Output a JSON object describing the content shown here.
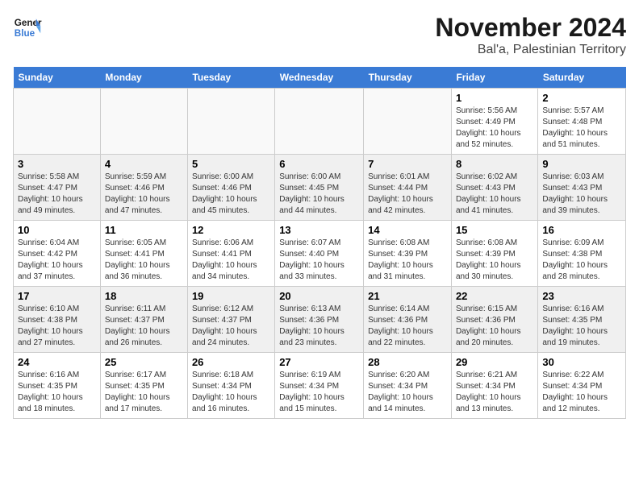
{
  "header": {
    "logo_line1": "General",
    "logo_line2": "Blue",
    "main_title": "November 2024",
    "subtitle": "Bal'a, Palestinian Territory"
  },
  "weekdays": [
    "Sunday",
    "Monday",
    "Tuesday",
    "Wednesday",
    "Thursday",
    "Friday",
    "Saturday"
  ],
  "weeks": [
    [
      {
        "day": "",
        "info": ""
      },
      {
        "day": "",
        "info": ""
      },
      {
        "day": "",
        "info": ""
      },
      {
        "day": "",
        "info": ""
      },
      {
        "day": "",
        "info": ""
      },
      {
        "day": "1",
        "info": "Sunrise: 5:56 AM\nSunset: 4:49 PM\nDaylight: 10 hours\nand 52 minutes."
      },
      {
        "day": "2",
        "info": "Sunrise: 5:57 AM\nSunset: 4:48 PM\nDaylight: 10 hours\nand 51 minutes."
      }
    ],
    [
      {
        "day": "3",
        "info": "Sunrise: 5:58 AM\nSunset: 4:47 PM\nDaylight: 10 hours\nand 49 minutes."
      },
      {
        "day": "4",
        "info": "Sunrise: 5:59 AM\nSunset: 4:46 PM\nDaylight: 10 hours\nand 47 minutes."
      },
      {
        "day": "5",
        "info": "Sunrise: 6:00 AM\nSunset: 4:46 PM\nDaylight: 10 hours\nand 45 minutes."
      },
      {
        "day": "6",
        "info": "Sunrise: 6:00 AM\nSunset: 4:45 PM\nDaylight: 10 hours\nand 44 minutes."
      },
      {
        "day": "7",
        "info": "Sunrise: 6:01 AM\nSunset: 4:44 PM\nDaylight: 10 hours\nand 42 minutes."
      },
      {
        "day": "8",
        "info": "Sunrise: 6:02 AM\nSunset: 4:43 PM\nDaylight: 10 hours\nand 41 minutes."
      },
      {
        "day": "9",
        "info": "Sunrise: 6:03 AM\nSunset: 4:43 PM\nDaylight: 10 hours\nand 39 minutes."
      }
    ],
    [
      {
        "day": "10",
        "info": "Sunrise: 6:04 AM\nSunset: 4:42 PM\nDaylight: 10 hours\nand 37 minutes."
      },
      {
        "day": "11",
        "info": "Sunrise: 6:05 AM\nSunset: 4:41 PM\nDaylight: 10 hours\nand 36 minutes."
      },
      {
        "day": "12",
        "info": "Sunrise: 6:06 AM\nSunset: 4:41 PM\nDaylight: 10 hours\nand 34 minutes."
      },
      {
        "day": "13",
        "info": "Sunrise: 6:07 AM\nSunset: 4:40 PM\nDaylight: 10 hours\nand 33 minutes."
      },
      {
        "day": "14",
        "info": "Sunrise: 6:08 AM\nSunset: 4:39 PM\nDaylight: 10 hours\nand 31 minutes."
      },
      {
        "day": "15",
        "info": "Sunrise: 6:08 AM\nSunset: 4:39 PM\nDaylight: 10 hours\nand 30 minutes."
      },
      {
        "day": "16",
        "info": "Sunrise: 6:09 AM\nSunset: 4:38 PM\nDaylight: 10 hours\nand 28 minutes."
      }
    ],
    [
      {
        "day": "17",
        "info": "Sunrise: 6:10 AM\nSunset: 4:38 PM\nDaylight: 10 hours\nand 27 minutes."
      },
      {
        "day": "18",
        "info": "Sunrise: 6:11 AM\nSunset: 4:37 PM\nDaylight: 10 hours\nand 26 minutes."
      },
      {
        "day": "19",
        "info": "Sunrise: 6:12 AM\nSunset: 4:37 PM\nDaylight: 10 hours\nand 24 minutes."
      },
      {
        "day": "20",
        "info": "Sunrise: 6:13 AM\nSunset: 4:36 PM\nDaylight: 10 hours\nand 23 minutes."
      },
      {
        "day": "21",
        "info": "Sunrise: 6:14 AM\nSunset: 4:36 PM\nDaylight: 10 hours\nand 22 minutes."
      },
      {
        "day": "22",
        "info": "Sunrise: 6:15 AM\nSunset: 4:36 PM\nDaylight: 10 hours\nand 20 minutes."
      },
      {
        "day": "23",
        "info": "Sunrise: 6:16 AM\nSunset: 4:35 PM\nDaylight: 10 hours\nand 19 minutes."
      }
    ],
    [
      {
        "day": "24",
        "info": "Sunrise: 6:16 AM\nSunset: 4:35 PM\nDaylight: 10 hours\nand 18 minutes."
      },
      {
        "day": "25",
        "info": "Sunrise: 6:17 AM\nSunset: 4:35 PM\nDaylight: 10 hours\nand 17 minutes."
      },
      {
        "day": "26",
        "info": "Sunrise: 6:18 AM\nSunset: 4:34 PM\nDaylight: 10 hours\nand 16 minutes."
      },
      {
        "day": "27",
        "info": "Sunrise: 6:19 AM\nSunset: 4:34 PM\nDaylight: 10 hours\nand 15 minutes."
      },
      {
        "day": "28",
        "info": "Sunrise: 6:20 AM\nSunset: 4:34 PM\nDaylight: 10 hours\nand 14 minutes."
      },
      {
        "day": "29",
        "info": "Sunrise: 6:21 AM\nSunset: 4:34 PM\nDaylight: 10 hours\nand 13 minutes."
      },
      {
        "day": "30",
        "info": "Sunrise: 6:22 AM\nSunset: 4:34 PM\nDaylight: 10 hours\nand 12 minutes."
      }
    ]
  ]
}
